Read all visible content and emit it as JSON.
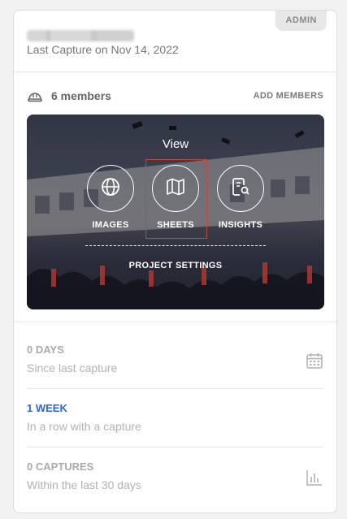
{
  "card": {
    "badge": "ADMIN",
    "last_capture": "Last Capture on Nov 14, 2022"
  },
  "members": {
    "count_label": "6 members",
    "add_label": "ADD MEMBERS"
  },
  "hero": {
    "view_label": "View",
    "actions": [
      {
        "label": "IMAGES",
        "icon": "globe-icon"
      },
      {
        "label": "SHEETS",
        "icon": "map-icon"
      },
      {
        "label": "INSIGHTS",
        "icon": "report-search-icon"
      }
    ],
    "settings_label": "PROJECT SETTINGS"
  },
  "stats": [
    {
      "value": "0 DAYS",
      "caption": "Since last capture",
      "icon": "calendar-icon"
    },
    {
      "value": "1 WEEK",
      "caption": "In a row with a capture",
      "color": "#2f67c9"
    },
    {
      "value": "0 CAPTURES",
      "caption": "Within the last 30 days",
      "icon": "bar-chart-icon"
    }
  ],
  "colors": {
    "accent": "#2f67c9",
    "highlight_border": "#c9463a"
  }
}
